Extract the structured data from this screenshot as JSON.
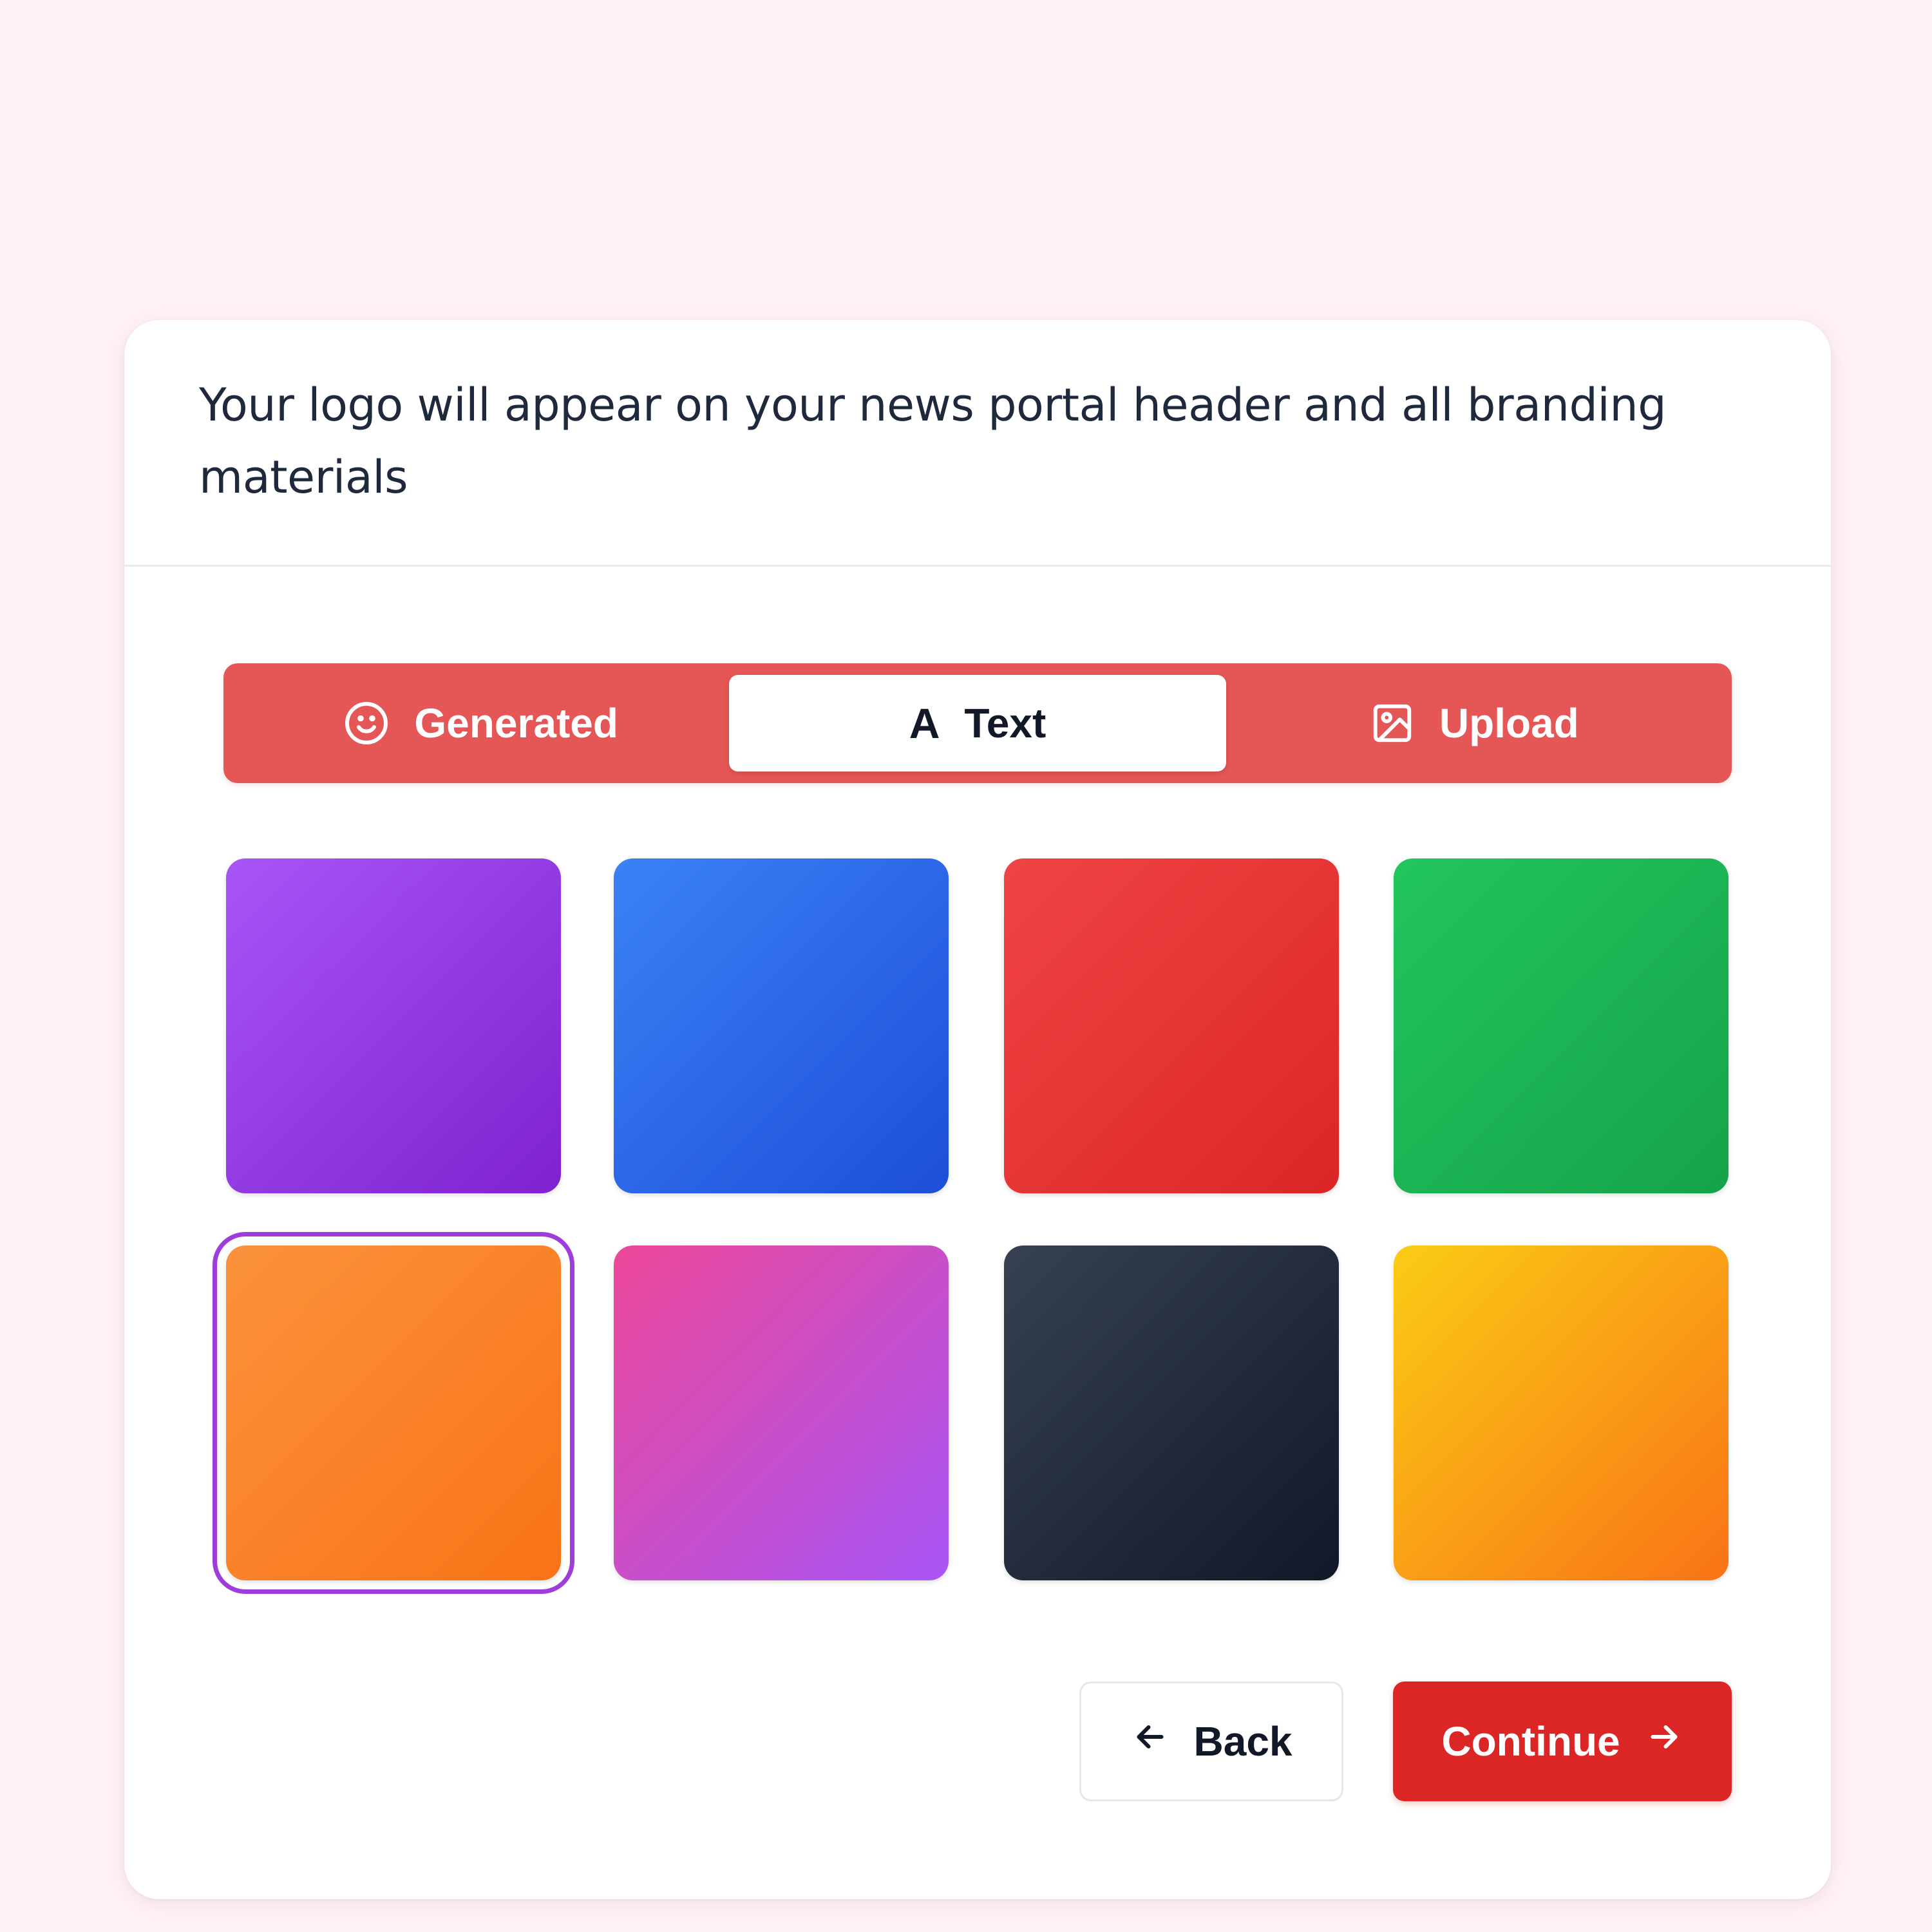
{
  "description": "Your logo will appear on your news portal header and all branding materials",
  "tabs": [
    {
      "label": "Generated",
      "icon": "smile-icon",
      "active": false
    },
    {
      "label": "Text",
      "icon": "letter-a-icon",
      "glyph": "A",
      "active": true
    },
    {
      "label": "Upload",
      "icon": "image-icon",
      "active": false
    }
  ],
  "colors": {
    "accent": "#e55656",
    "primary_button": "#dc2626",
    "selected_outline": "#9f3ddb",
    "swatches": [
      {
        "name": "purple",
        "from": "#a855f7",
        "to": "#7e22ce"
      },
      {
        "name": "blue",
        "from": "#3b82f6",
        "to": "#1d4ed8"
      },
      {
        "name": "red",
        "from": "#ef4444",
        "to": "#dc2626"
      },
      {
        "name": "green",
        "from": "#22c55e",
        "to": "#16a34a"
      },
      {
        "name": "orange",
        "from": "#fb923c",
        "to": "#f97316",
        "selected": true
      },
      {
        "name": "pink",
        "from": "#ec4899",
        "to": "#a855f7"
      },
      {
        "name": "dark",
        "from": "#374151",
        "to": "#111827"
      },
      {
        "name": "yellow",
        "from": "#facc15",
        "to": "#f97316"
      }
    ]
  },
  "buttons": {
    "back_label": "Back",
    "continue_label": "Continue"
  }
}
